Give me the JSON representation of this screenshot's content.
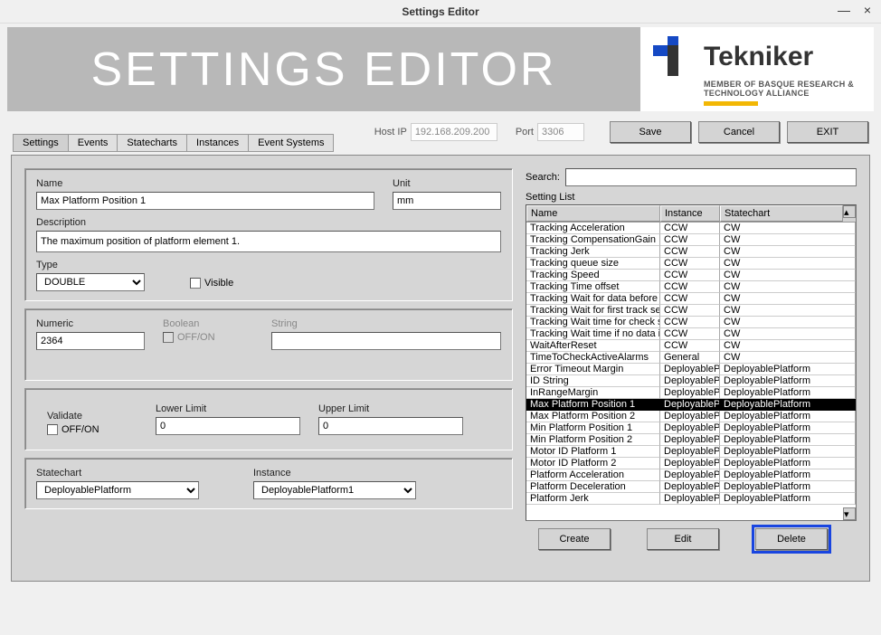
{
  "window": {
    "title": "Settings Editor"
  },
  "banner": {
    "title": "SETTINGS EDITOR",
    "brand": "Tekniker",
    "tagline": "MEMBER OF BASQUE RESEARCH\n& TECHNOLOGY ALLIANCE"
  },
  "host": {
    "host_label": "Host IP",
    "host_ip": "192.168.209.200",
    "port_label": "Port",
    "port": "3306"
  },
  "buttons": {
    "save": "Save",
    "cancel": "Cancel",
    "exit": "EXIT",
    "create": "Create",
    "edit": "Edit",
    "delete": "Delete"
  },
  "tabs": [
    "Settings",
    "Events",
    "Statecharts",
    "Instances",
    "Event Systems"
  ],
  "labels": {
    "name": "Name",
    "unit": "Unit",
    "description": "Description",
    "type": "Type",
    "visible": "Visible",
    "numeric": "Numeric",
    "boolean": "Boolean",
    "offon": "OFF/ON",
    "string": "String",
    "validate": "Validate",
    "lower": "Lower Limit",
    "upper": "Upper Limit",
    "statechart": "Statechart",
    "instance": "Instance",
    "search": "Search:",
    "setting_list": "Setting List"
  },
  "form": {
    "name": "Max Platform Position 1",
    "unit": "mm",
    "description": "The maximum position of platform element 1.",
    "type": "DOUBLE",
    "numeric": "2364",
    "lower": "0",
    "upper": "0",
    "statechart": "DeployablePlatform",
    "instance": "DeployablePlatform1"
  },
  "list": {
    "headers": [
      "Name",
      "Instance",
      "Statechart"
    ],
    "rows": [
      {
        "n": "Tracking Acceleration",
        "i": "CCW",
        "s": "CW"
      },
      {
        "n": "Tracking CompensationGain",
        "i": "CCW",
        "s": "CW"
      },
      {
        "n": "Tracking Jerk",
        "i": "CCW",
        "s": "CW"
      },
      {
        "n": "Tracking queue size",
        "i": "CCW",
        "s": "CW"
      },
      {
        "n": "Tracking Speed",
        "i": "CCW",
        "s": "CW"
      },
      {
        "n": "Tracking Time offset",
        "i": "CCW",
        "s": "CW"
      },
      {
        "n": "Tracking Wait for data before e",
        "i": "CCW",
        "s": "CW"
      },
      {
        "n": "Tracking Wait for first track setp",
        "i": "CCW",
        "s": "CW"
      },
      {
        "n": "Tracking Wait time for check se",
        "i": "CCW",
        "s": "CW"
      },
      {
        "n": "Tracking Wait time if no data in",
        "i": "CCW",
        "s": "CW"
      },
      {
        "n": "WaitAfterReset",
        "i": "CCW",
        "s": "CW"
      },
      {
        "n": "TimeToCheckActiveAlarms",
        "i": "General",
        "s": "CW"
      },
      {
        "n": "Error Timeout Margin",
        "i": "DeployableP",
        "s": "DeployablePlatform"
      },
      {
        "n": "ID String",
        "i": "DeployableP",
        "s": "DeployablePlatform"
      },
      {
        "n": "InRangeMargin",
        "i": "DeployableP",
        "s": "DeployablePlatform"
      },
      {
        "n": "Max Platform Position 1",
        "i": "DeployableP",
        "s": "DeployablePlatform",
        "sel": true
      },
      {
        "n": "Max Platform Position 2",
        "i": "DeployableP",
        "s": "DeployablePlatform"
      },
      {
        "n": "Min Platform Position 1",
        "i": "DeployableP",
        "s": "DeployablePlatform"
      },
      {
        "n": "Min Platform Position 2",
        "i": "DeployableP",
        "s": "DeployablePlatform"
      },
      {
        "n": "Motor ID Platform 1",
        "i": "DeployableP",
        "s": "DeployablePlatform"
      },
      {
        "n": "Motor ID Platform 2",
        "i": "DeployableP",
        "s": "DeployablePlatform"
      },
      {
        "n": "Platform Acceleration",
        "i": "DeployableP",
        "s": "DeployablePlatform"
      },
      {
        "n": "Platform Deceleration",
        "i": "DeployableP",
        "s": "DeployablePlatform"
      },
      {
        "n": "Platform Jerk",
        "i": "DeployableP",
        "s": "DeployablePlatform"
      }
    ]
  }
}
